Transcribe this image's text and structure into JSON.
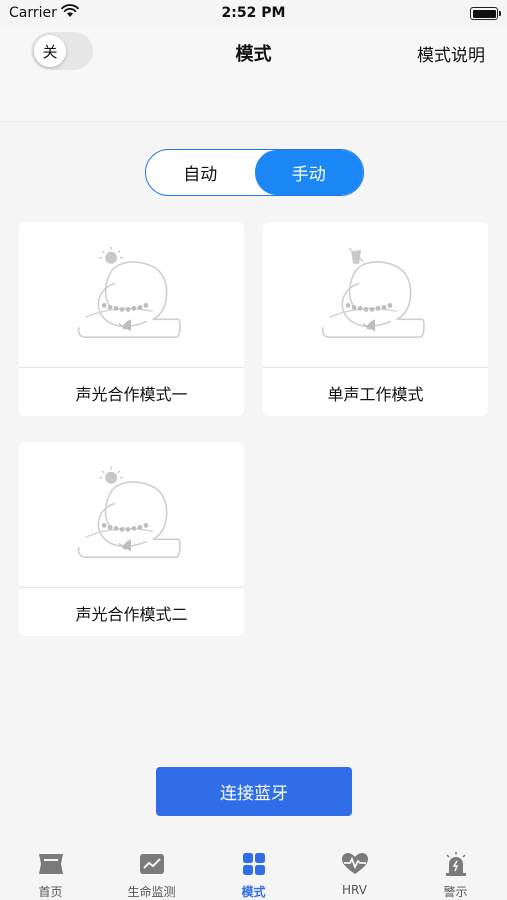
{
  "status_bar": {
    "carrier": "Carrier",
    "time": "2:52 PM"
  },
  "nav": {
    "toggle_label": "关",
    "title": "模式",
    "right_link": "模式说明"
  },
  "segmented": {
    "auto": "自动",
    "manual": "手动",
    "selected": "manual"
  },
  "cards": [
    {
      "label": "声光合作模式一",
      "icon": "sound-light-sleeper-illustration"
    },
    {
      "label": "单声工作模式",
      "icon": "sound-only-sleeper-illustration"
    },
    {
      "label": "声光合作模式二",
      "icon": "sound-light-sleeper-illustration"
    }
  ],
  "connect_button": "连接蓝牙",
  "tabbar": {
    "active": "mode",
    "items": [
      {
        "label": "首页",
        "icon": "home-icon"
      },
      {
        "label": "生命监测",
        "icon": "monitor-icon"
      },
      {
        "label": "模式",
        "icon": "grid-icon"
      },
      {
        "label": "HRV",
        "icon": "heartbeat-icon"
      },
      {
        "label": "警示",
        "icon": "alarm-icon"
      }
    ]
  },
  "colors": {
    "accent": "#2f6ee8",
    "segment_active": "#1b86f5",
    "background": "#f5f5f5"
  }
}
